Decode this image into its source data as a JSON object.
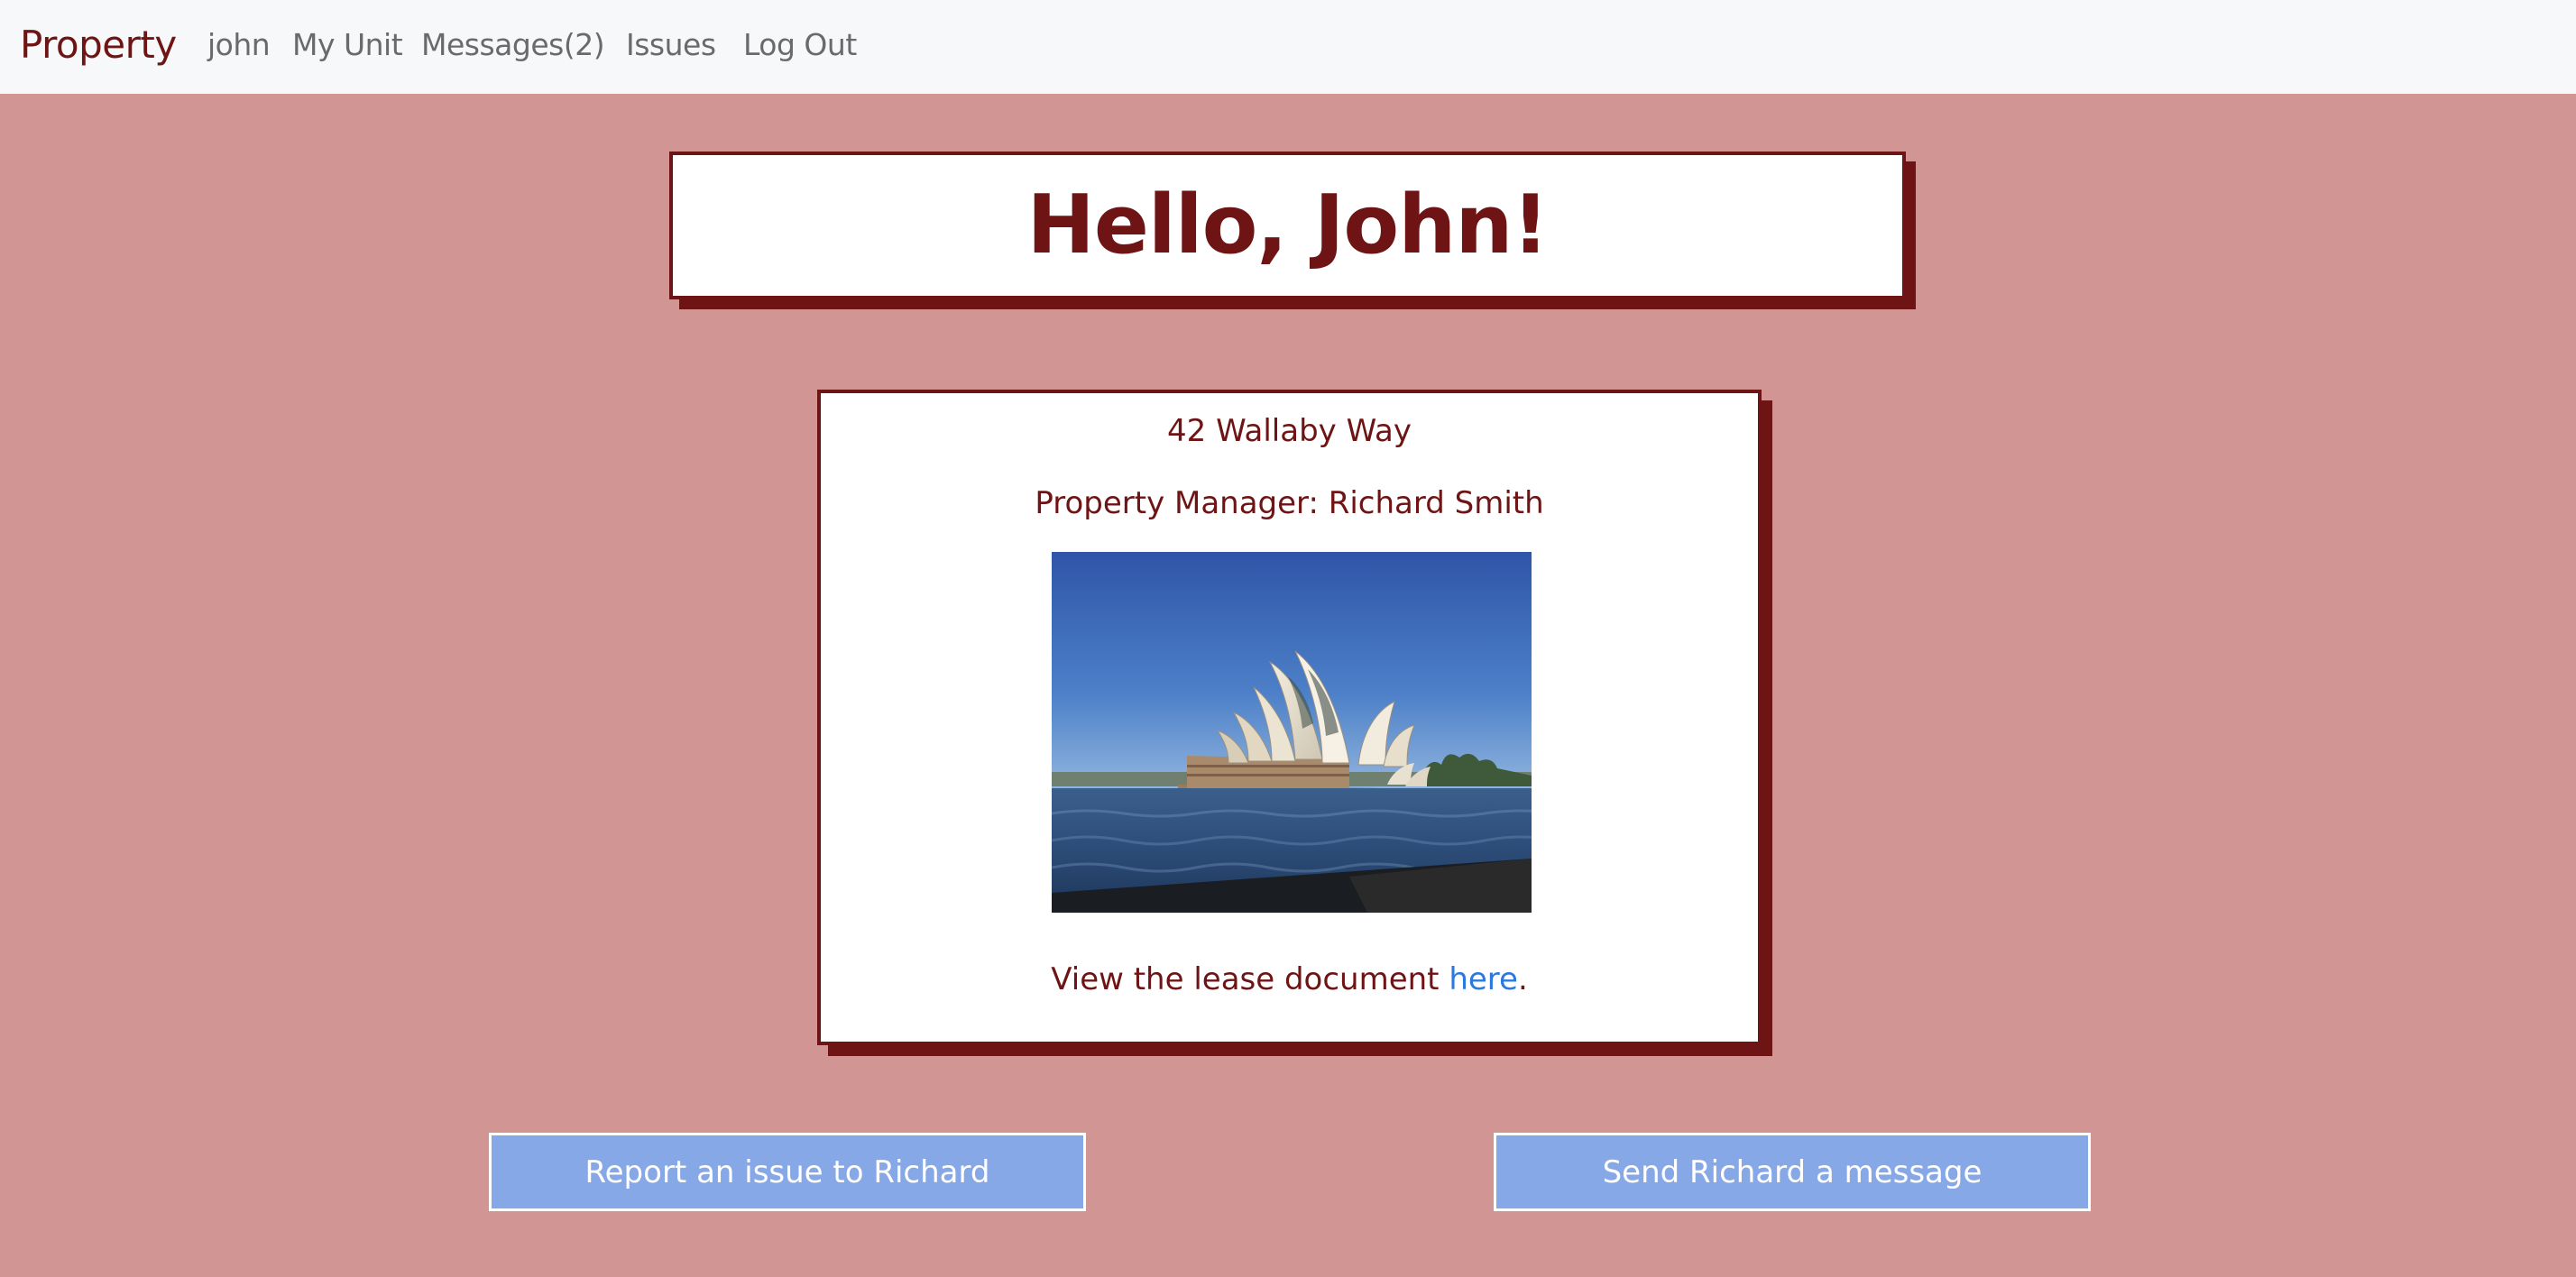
{
  "navbar": {
    "brand": "Property",
    "links": [
      {
        "label": "john"
      },
      {
        "label": "My Unit"
      },
      {
        "label": "Messages(2)"
      },
      {
        "label": "Issues"
      },
      {
        "label": "Log Out"
      }
    ]
  },
  "greeting": "Hello, John!",
  "unit": {
    "address": "42 Wallaby Way",
    "manager_prefix": "Property Manager: ",
    "manager_name": "Richard Smith",
    "lease_text": "View the lease document ",
    "lease_link": "here",
    "lease_suffix": "."
  },
  "actions": {
    "report_issue": "Report an issue to Richard",
    "send_message": "Send Richard a message"
  },
  "colors": {
    "page_background": "#d19594",
    "accent_dark_red": "#6e1414",
    "button_blue": "#87a8e6",
    "link_blue": "#2a78e0",
    "navbar_bg": "#f7f8fa"
  }
}
